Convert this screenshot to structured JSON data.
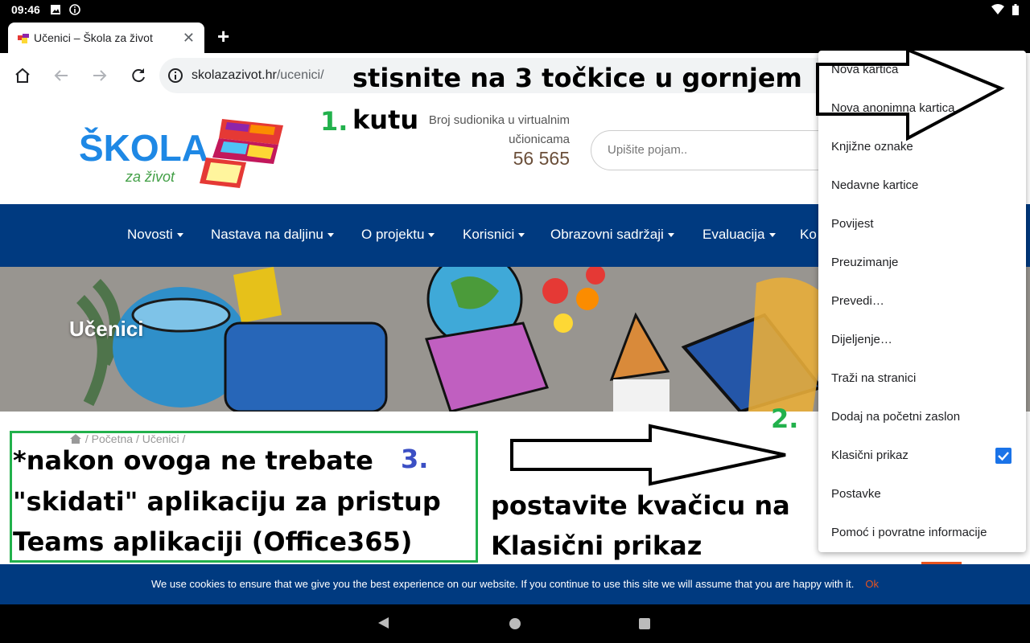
{
  "status_bar": {
    "time": "09:46"
  },
  "tab": {
    "title": "Učenici – Škola za život"
  },
  "omnibox": {
    "domain": "skolazazivot.hr",
    "path": "/ucenici/"
  },
  "site": {
    "logo_text": "ŠKOLA",
    "logo_subtext": "za život",
    "counter_label": "Broj sudionika u virtualnim učionicama",
    "counter_value": "56 565",
    "search_placeholder": "Upišite pojam.."
  },
  "nav": {
    "items": [
      {
        "label": "Novosti"
      },
      {
        "label": "Nastava na daljinu"
      },
      {
        "label": "O projektu"
      },
      {
        "label": "Korisnici"
      },
      {
        "label": "Obrazovni sadržaji"
      },
      {
        "label": "Evaluacija"
      },
      {
        "label": "Ko"
      }
    ]
  },
  "hero": {
    "title": "Učenici"
  },
  "breadcrumb": {
    "home": "Početna",
    "current": "Učenici",
    "sep": "/"
  },
  "annotations": {
    "step1_number": "1.",
    "step1_line1": "stisnite na 3 točkice u gornjem",
    "step1_line2": "kutu",
    "step2_number": "2.",
    "step2_line1": "postavite kvačicu na",
    "step2_line2": "Klasični prikaz",
    "step3_number": "3.",
    "step3_line1": "*nakon ovoga ne trebate",
    "step3_line2": "\"skidati\" aplikaciju za pristup",
    "step3_line3": "Teams aplikaciji (Office365)"
  },
  "cookie": {
    "message": "We use cookies to ensure that we give you the best experience on our website. If you continue to use this site we will assume that you are happy with it.",
    "ok": "Ok"
  },
  "menu": {
    "items": [
      {
        "label": "Nova kartica"
      },
      {
        "label": "Nova anonimna kartica"
      },
      {
        "label": "Knjižne oznake"
      },
      {
        "label": "Nedavne kartice"
      },
      {
        "label": "Povijest"
      },
      {
        "label": "Preuzimanje"
      },
      {
        "label": "Prevedi…"
      },
      {
        "label": "Dijeljenje…"
      },
      {
        "label": "Traži na stranici"
      },
      {
        "label": "Dodaj na početni zaslon"
      },
      {
        "label": "Klasični prikaz",
        "checked": true
      },
      {
        "label": "Postavke"
      },
      {
        "label": "Pomoć i povratne informacije"
      }
    ]
  },
  "colors": {
    "nav_blue": "#003a80",
    "accent_orange": "#e8541f",
    "annotation_green": "#22b14c",
    "annotation_blue": "#3b4fc4",
    "checkbox_blue": "#1a73e8"
  }
}
